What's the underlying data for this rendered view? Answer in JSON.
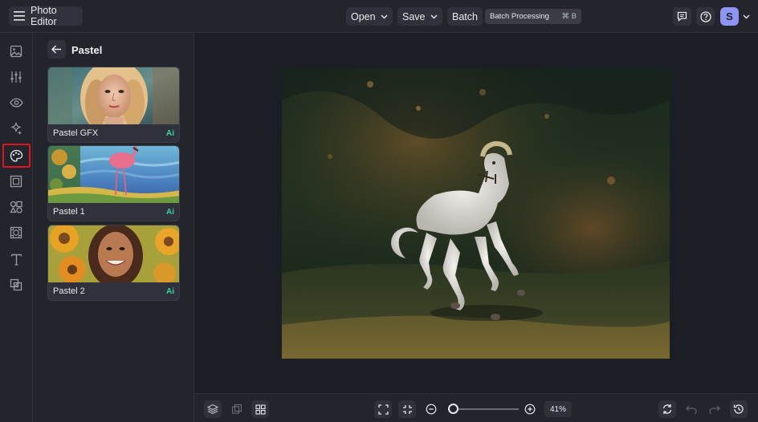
{
  "app": {
    "title": "Photo Editor"
  },
  "toolbar": {
    "open_label": "Open",
    "save_label": "Save",
    "batch_label": "Batch",
    "tooltip_text": "Batch Processing",
    "tooltip_shortcut": "⌘ B"
  },
  "user": {
    "initial": "S",
    "avatar_color": "#8f95f2"
  },
  "rail": {
    "items": [
      "image-icon",
      "sliders-icon",
      "eye-icon",
      "magic-icon",
      "palette-icon",
      "frame-icon",
      "shapes-icon",
      "texture-icon",
      "text-icon",
      "overlay-icon"
    ],
    "active_index": 4,
    "highlight_color": "#e0141d"
  },
  "panel": {
    "title": "Pastel",
    "effects": [
      {
        "label": "Pastel GFX",
        "badge": "Ai"
      },
      {
        "label": "Pastel 1",
        "badge": "Ai"
      },
      {
        "label": "Pastel 2",
        "badge": "Ai"
      }
    ]
  },
  "zoom": {
    "value_label": "41%",
    "level": 0.07
  },
  "colors": {
    "accent_badge": "#38d39f",
    "background": "#1e2028"
  }
}
